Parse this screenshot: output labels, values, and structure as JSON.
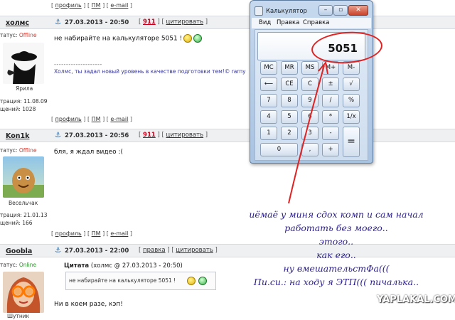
{
  "post_links": {
    "profile": "профиль",
    "pm": "ПМ",
    "email": "e-mail"
  },
  "posts": [
    {
      "user": "холмс",
      "date": "27.03.2013 - 20:50",
      "number": "911",
      "quote_action": "цитировать",
      "status_label": "татус:",
      "status_value": "Offline",
      "avatar_caption": "Ярила",
      "reg_label": "трация:",
      "reg_date": "11.08.09",
      "msg_label": "щений:",
      "msg_count": "1028",
      "text": "не набирайте на калькуляторе 5051 !",
      "sig_dashes": "--------------------",
      "signature": "Холмс, ты задал новый уровень в качестве подготовки тем!© rarny"
    },
    {
      "user": "Kon1k",
      "date": "27.03.2013 - 20:56",
      "number": "911",
      "quote_action": "цитировать",
      "status_label": "татус:",
      "status_value": "Offline",
      "avatar_caption": "Весельчак",
      "reg_label": "трация:",
      "reg_date": "21.01.13",
      "msg_label": "щений:",
      "msg_count": "166",
      "text": "бля, я ждал видео :("
    },
    {
      "user": "Goobla",
      "date": "27.03.2013 - 22:00",
      "edit_action": "правка",
      "quote_action": "цитировать",
      "status_label": "татус:",
      "status_value": "Online",
      "avatar_caption": "Шутник",
      "quote_title": "Цитата",
      "quote_source": "(холмс @ 27.03.2013 - 20:50)",
      "quote_text": "не набирайте на калькуляторе 5051 !",
      "text": "Ни в коем разе, кэп!"
    }
  ],
  "calculator": {
    "title": "Калькулятор",
    "menu": [
      "Вид",
      "Правка",
      "Справка"
    ],
    "display": "5051",
    "keys": {
      "mc": "MC",
      "mr": "MR",
      "ms": "MS",
      "mplus": "M+",
      "mminus": "M-",
      "back": "⟵",
      "ce": "CE",
      "c": "C",
      "pm": "±",
      "sqrt": "√",
      "k7": "7",
      "k8": "8",
      "k9": "9",
      "div": "/",
      "pct": "%",
      "k4": "4",
      "k5": "5",
      "k6": "6",
      "mul": "*",
      "inv": "1/x",
      "k1": "1",
      "k2": "2",
      "k3": "3",
      "sub": "-",
      "eq": "=",
      "k0": "0",
      "dot": ",",
      "add": "+"
    }
  },
  "caption_lines": [
    "иёмаё у миня сдох комп и сам начал",
    "работать без моего..",
    "этого..",
    "как его..",
    "ну вмешательстФа(((",
    "Пи.си.: на ходу я ЭТП((( пичалька.."
  ],
  "watermark": "YAPLAKAL.COM",
  "colors": {
    "annotation_red": "#e02222",
    "caption_blue": "#2b1f8a"
  }
}
